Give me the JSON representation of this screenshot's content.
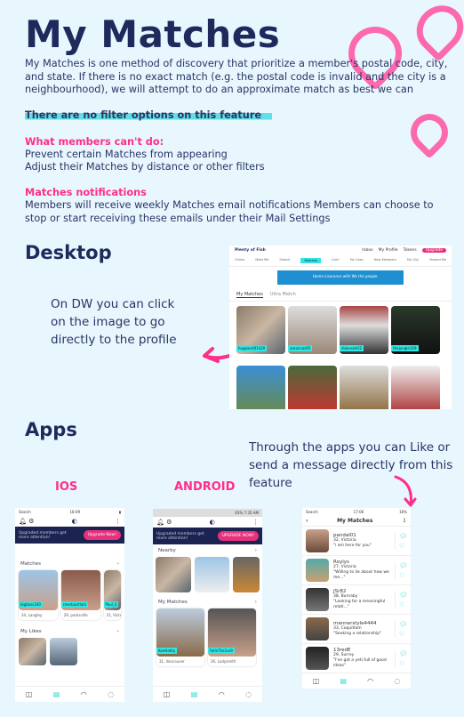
{
  "title": "My Matches",
  "intro": "My Matches is one method of discovery that prioritize a member's postal code, city, and state. If there is no exact match (e.g. the postal code is invalid and the city is a neighbourhood), we will attempt to do an approximate match as best we can",
  "highlight": "There are no filter options on this feature",
  "cant_do": {
    "heading": "What members can't do:",
    "items": [
      "Prevent certain Matches from appearing",
      "Adjust their Matches by distance or other filters"
    ]
  },
  "notifications": {
    "heading": "Matches notifications",
    "text": "Members will receive weekly Matches email notifications Members can choose to stop or start receiving these emails under their Mail Settings"
  },
  "desktop": {
    "heading": "Desktop",
    "note": "On DW you can click on the image to go directly to the profile",
    "screenshot": {
      "logo": "Plenty of Fish",
      "top": [
        "Inbox",
        "My Profile",
        "Tokens",
        "Upgrade"
      ],
      "nav": [
        "Online",
        "Meet Me",
        "Search",
        "Matches",
        "Live!",
        "My Likes",
        "New Members",
        "My City",
        "Viewed Me"
      ],
      "active_nav": "Matches",
      "ad": "Home insurance with We the people",
      "tabs": [
        "My Matches",
        "Ultra Match"
      ],
      "users": [
        "hugoand01420",
        "aaroncas95",
        "dukevale52",
        "thejungle109"
      ]
    }
  },
  "apps": {
    "heading": "Apps",
    "note": "Through the apps you can Like or send a message directly from this feature",
    "ios_label": "IOS",
    "android_label": "ANDROID",
    "ios": {
      "time": "18:09",
      "carrier": "Search",
      "banner": "Upgraded members get more attention!",
      "upgrade": "Upgrade Now!",
      "matches": "Matches",
      "likes": "My Likes",
      "cards": [
        {
          "user": "bigboss330",
          "info": "34, Langley"
        },
        {
          "user": "ceestuartlark",
          "info": "29, parksville"
        },
        {
          "user": "Paul_S",
          "info": "31, Victo"
        }
      ]
    },
    "android": {
      "status": "63% 7:35 AM",
      "banner": "Upgraded members get more attention!",
      "upgrade": "UPGRADE NOW!",
      "nearby": "Nearby",
      "matches": "My Matches",
      "cards": [
        {
          "user": "KeeHathy",
          "info": "31, Vancouver"
        },
        {
          "user": "FallnThe1ss9",
          "info": "26, Ladysmith"
        }
      ]
    },
    "list": {
      "time": "17:06",
      "battery": "16%",
      "title": "My Matches",
      "items": [
        {
          "user": "pandal01",
          "info": "32, Victoria",
          "msg": "\"i am here for you\""
        },
        {
          "user": "Roylys",
          "info": "27, Victoria",
          "msg": "\"Willing to lie about how we me...\""
        },
        {
          "user": "JSr82",
          "info": "38, Burnaby",
          "msg": "\"Looking for a meaningful relati...\""
        },
        {
          "user": "mannerstyle4444",
          "info": "33, Coquitlam",
          "msg": "\"Seeking a relationship\""
        },
        {
          "user": "13redE",
          "info": "29, Surrey",
          "msg": "\"I've got a yeti full of good ideas\""
        },
        {
          "user": "KBall88",
          "info": "34, Burnaby",
          "msg": ""
        }
      ]
    }
  },
  "colors": {
    "navy": "#1f2a5c",
    "pink": "#ff2e8a",
    "teal": "#33e6e0",
    "bg": "#e8f6fd"
  }
}
